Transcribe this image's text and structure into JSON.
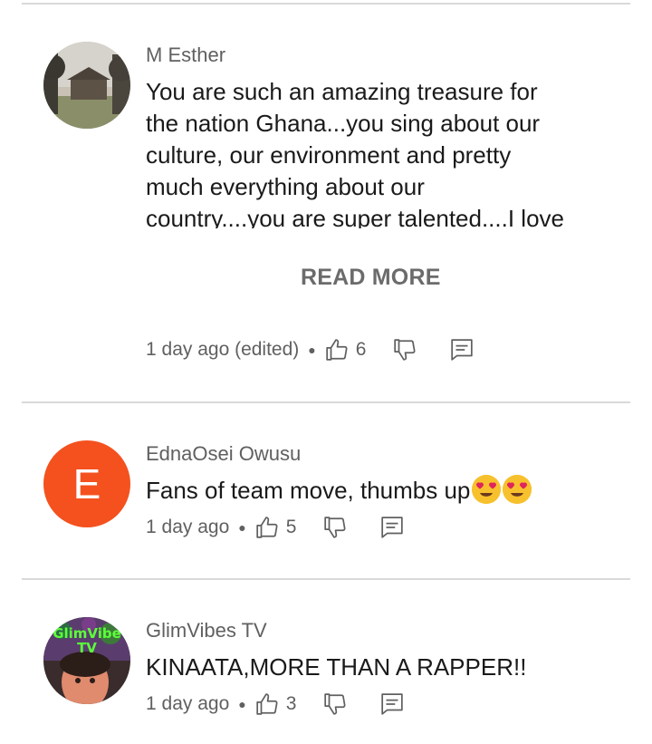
{
  "comments": [
    {
      "author": "M Esther",
      "lines": [
        "You are such an amazing treasure for",
        "the nation Ghana...you sing about our",
        "culture, our environment and pretty",
        "much everything about our",
        "country....you are super talented....I love"
      ],
      "read_more": "READ MORE",
      "time": "1 day ago (edited)",
      "likes": "6"
    },
    {
      "author": "EdnaOsei Owusu",
      "avatar_letter": "E",
      "avatar_color": "#f4511e",
      "text": "Fans of team move, thumbs up",
      "emojis": [
        "heart-eyes-emoji",
        "heart-eyes-emoji"
      ],
      "time": "1 day ago",
      "likes": "5"
    },
    {
      "author": "GlimVibes TV",
      "avatar_text": "GlimVibe TV",
      "text": "KINAATA,MORE THAN A RAPPER!!",
      "time": "1 day ago",
      "likes": "3"
    }
  ],
  "icons": {
    "like": "thumbs-up-icon",
    "dislike": "thumbs-down-icon",
    "reply": "reply-icon"
  }
}
